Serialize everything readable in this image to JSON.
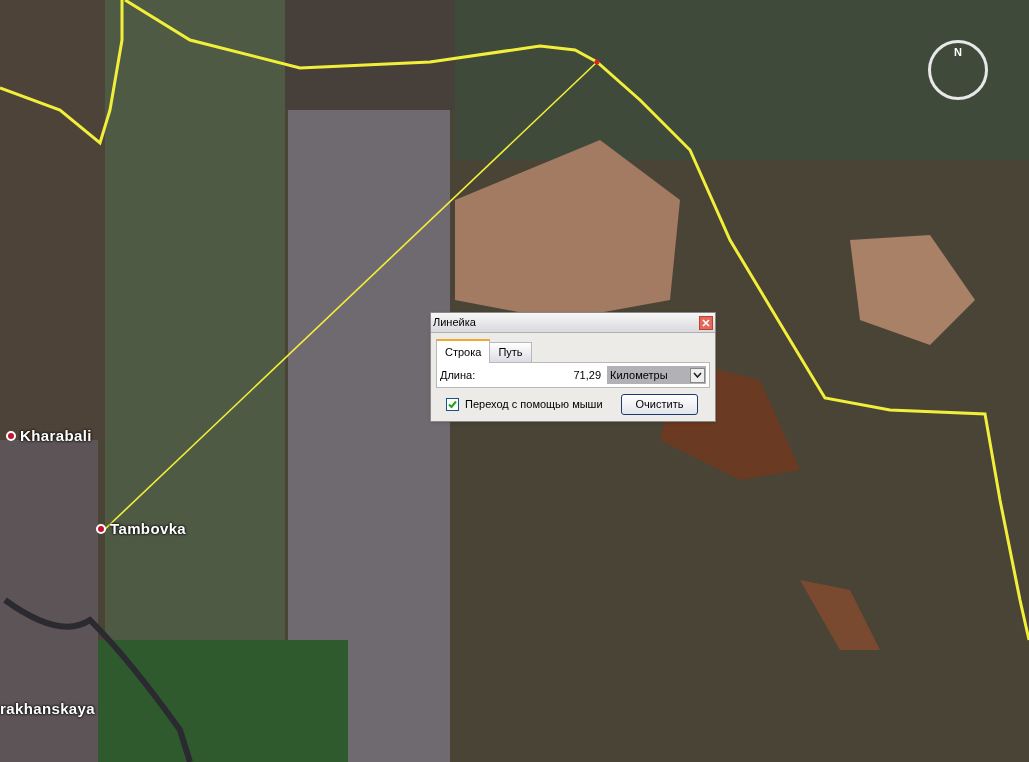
{
  "map": {
    "compass": {
      "label": "N"
    },
    "places": [
      {
        "name": "Kharabali",
        "marker": true
      },
      {
        "name": "Tambovka",
        "marker": true
      },
      {
        "name": "rakhanskaya",
        "marker": false
      }
    ]
  },
  "ruler_dialog": {
    "title": "Линейка",
    "tabs": [
      {
        "label": "Строка",
        "selected": true
      },
      {
        "label": "Путь",
        "selected": false
      }
    ],
    "length_label": "Длина:",
    "length_value": "71,29",
    "unit": "Километры",
    "mouse_navigation": {
      "label": "Переход с помощью мыши",
      "checked": true
    },
    "clear_button": "Очистить"
  }
}
